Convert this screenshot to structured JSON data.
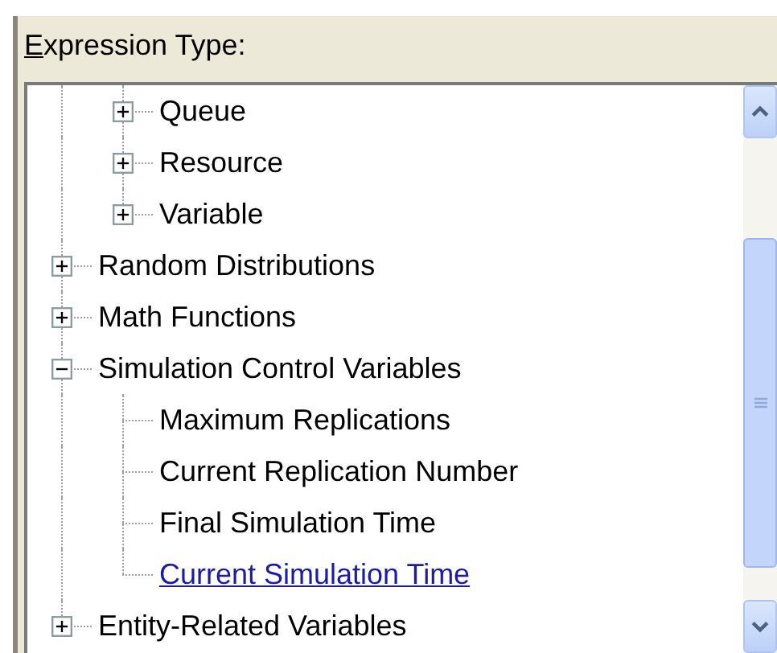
{
  "label": {
    "mnemonic": "E",
    "rest": "xpression Type:"
  },
  "tree": {
    "continued_children": [
      {
        "label": "Queue",
        "expanded": false,
        "selected": false
      },
      {
        "label": "Resource",
        "expanded": false,
        "selected": false
      },
      {
        "label": "Variable",
        "expanded": false,
        "selected": false
      }
    ],
    "items": [
      {
        "label": "Random Distributions",
        "expanded": false,
        "selected": false
      },
      {
        "label": "Math Functions",
        "expanded": false,
        "selected": false
      },
      {
        "label": "Simulation Control Variables",
        "expanded": true,
        "selected": false,
        "children": [
          {
            "label": "Maximum Replications",
            "selected": false
          },
          {
            "label": "Current Replication Number",
            "selected": false
          },
          {
            "label": "Final Simulation Time",
            "selected": false
          },
          {
            "label": "Current Simulation Time",
            "selected": true
          }
        ]
      },
      {
        "label": "Entity-Related Variables",
        "expanded": false,
        "selected": false
      }
    ]
  }
}
